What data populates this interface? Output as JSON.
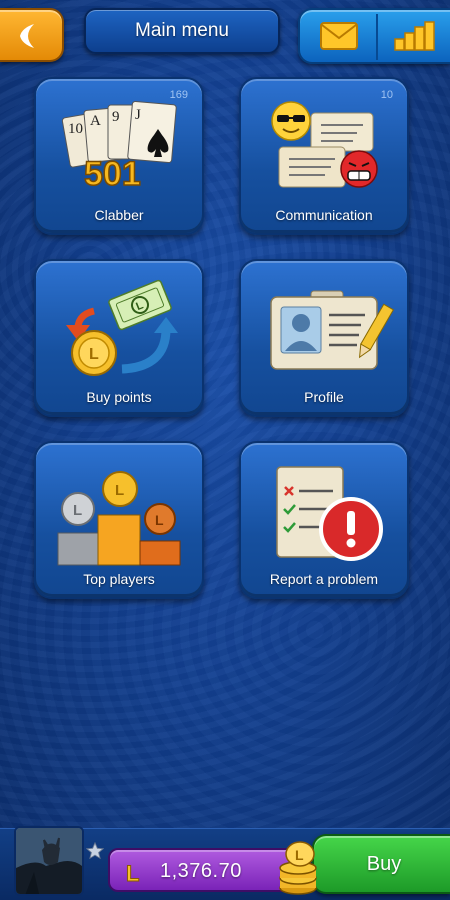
{
  "header": {
    "title": "Main menu"
  },
  "tiles": [
    {
      "label": "Clabber",
      "count": "169",
      "score": "501"
    },
    {
      "label": "Communication",
      "count": "10"
    },
    {
      "label": "Buy points"
    },
    {
      "label": "Profile"
    },
    {
      "label": "Top players"
    },
    {
      "label": "Report a problem"
    }
  ],
  "footer": {
    "balance": "1,376.70",
    "buy_label": "Buy"
  },
  "colors": {
    "accent_orange": "#f59f12",
    "tile_blue": "#1b5cb5",
    "buy_green": "#2fb836",
    "balance_purple": "#9a3fd1"
  },
  "icons": [
    "back-arrow-icon",
    "mail-icon",
    "leaderboard-icon",
    "star-icon",
    "coin-icon"
  ]
}
